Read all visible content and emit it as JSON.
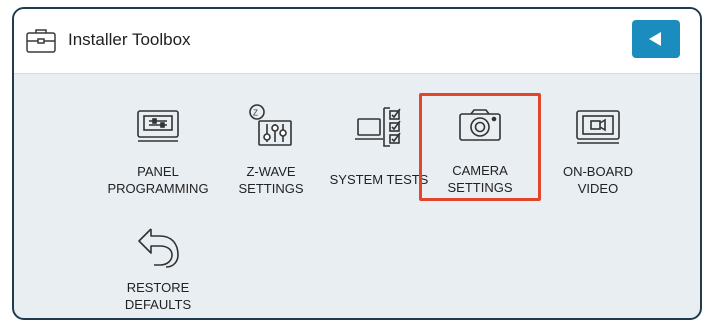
{
  "header": {
    "title": "Installer Toolbox",
    "back_icon": "back-arrow-icon"
  },
  "colors": {
    "accent": "#1a8dbe",
    "selection": "#e2452a",
    "border": "#1f3c4e",
    "background": "#e9eef2"
  },
  "tiles": [
    {
      "line1": "PANEL",
      "line2": "PROGRAMMING",
      "icon": "panel-icon"
    },
    {
      "line1": "Z-WAVE",
      "line2": "SETTINGS",
      "icon": "z-wave-settings-icon"
    },
    {
      "line1": "SYSTEM TESTS",
      "line2": "",
      "icon": "system-tests-icon"
    },
    {
      "line1": "CAMERA",
      "line2": "SETTINGS",
      "icon": "camera-icon",
      "selected": true
    },
    {
      "line1": "ON-BOARD",
      "line2": "VIDEO",
      "icon": "video-icon"
    },
    {
      "line1": "RESTORE",
      "line2": "DEFAULTS",
      "icon": "restore-icon"
    }
  ]
}
